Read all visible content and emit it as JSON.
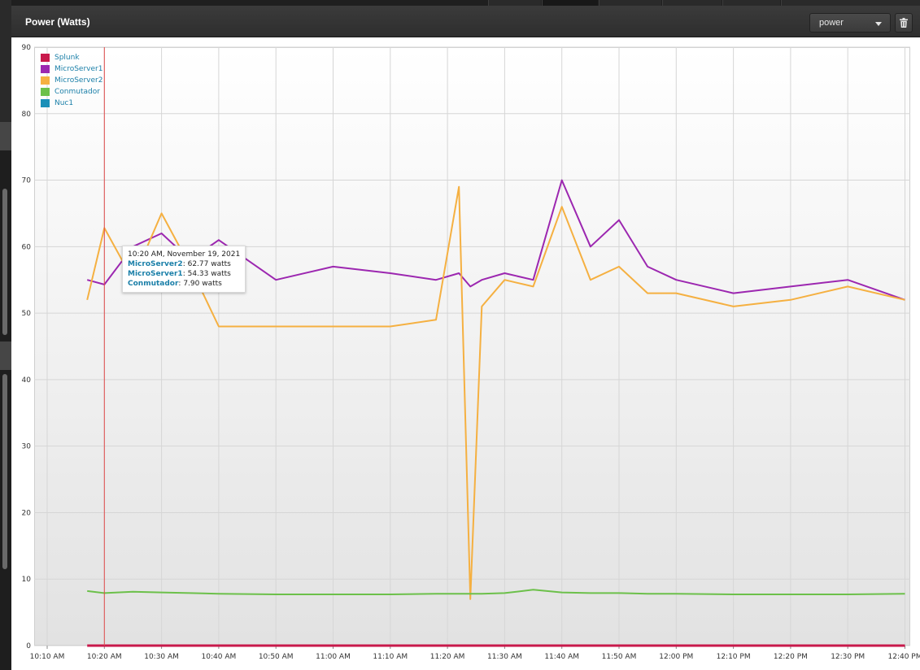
{
  "panel": {
    "title": "Power (Watts)",
    "metric_select": {
      "selected": "power"
    },
    "delete_icon": "trash-icon"
  },
  "tooltip": {
    "timestamp": "10:20 AM, November 19, 2021",
    "rows": [
      {
        "series": "MicroServer2",
        "value": "62.77 watts"
      },
      {
        "series": "MicroServer1",
        "value": "54.33 watts"
      },
      {
        "series": "Conmutador",
        "value": "7.90 watts"
      }
    ]
  },
  "chart_data": {
    "type": "line",
    "title": "",
    "xlabel": "",
    "ylabel": "",
    "ylim": [
      0,
      90
    ],
    "y_ticks": [
      0,
      10,
      20,
      30,
      40,
      50,
      60,
      70,
      80,
      90
    ],
    "x_ticks": [
      "10:10 AM",
      "10:20 AM",
      "10:30 AM",
      "10:40 AM",
      "10:50 AM",
      "11:00 AM",
      "11:10 AM",
      "11:20 AM",
      "11:30 AM",
      "11:40 AM",
      "11:50 AM",
      "12:00 PM",
      "12:10 PM",
      "12:20 PM",
      "12:30 PM",
      "12:40 PM"
    ],
    "xlim": [
      "10:10 AM",
      "12:40 PM"
    ],
    "grid": "both",
    "legend_position": "top-left",
    "cursor_time": "10:20 AM",
    "x": [
      "10:17 AM",
      "10:20 AM",
      "10:25 AM",
      "10:30 AM",
      "10:35 AM",
      "10:40 AM",
      "10:50 AM",
      "11:00 AM",
      "11:10 AM",
      "11:18 AM",
      "11:22 AM",
      "11:24 AM",
      "11:26 AM",
      "11:30 AM",
      "11:35 AM",
      "11:40 AM",
      "11:45 AM",
      "11:50 AM",
      "11:55 AM",
      "12:00 PM",
      "12:10 PM",
      "12:20 PM",
      "12:30 PM",
      "12:40 PM"
    ],
    "series": [
      {
        "name": "Splunk",
        "color": "#c8194b",
        "values": [
          0,
          0,
          0,
          0,
          0,
          0,
          0,
          0,
          0,
          0,
          0,
          0,
          0,
          0,
          0,
          0,
          0,
          0,
          0,
          0,
          0,
          0,
          0,
          0
        ]
      },
      {
        "name": "MicroServer1",
        "color": "#9c27b0",
        "values": [
          55,
          54.3,
          60,
          62,
          58,
          61,
          55,
          57,
          56,
          55,
          56,
          54,
          55,
          56,
          55,
          70,
          60,
          64,
          57,
          55,
          53,
          54,
          55,
          52
        ]
      },
      {
        "name": "MicroServer2",
        "color": "#f5b041",
        "values": [
          52,
          62.8,
          55,
          65,
          57,
          48,
          48,
          48,
          48,
          49,
          69,
          7,
          51,
          55,
          54,
          66,
          55,
          57,
          53,
          53,
          51,
          52,
          54,
          52
        ]
      },
      {
        "name": "Conmutador",
        "color": "#6cc04a",
        "values": [
          8.2,
          7.9,
          8.1,
          8.0,
          7.9,
          7.8,
          7.7,
          7.7,
          7.7,
          7.8,
          7.8,
          7.8,
          7.8,
          7.9,
          8.4,
          8.0,
          7.9,
          7.9,
          7.8,
          7.8,
          7.7,
          7.7,
          7.7,
          7.8
        ]
      },
      {
        "name": "Nuc1",
        "color": "#1a8fb8",
        "values": []
      }
    ]
  }
}
